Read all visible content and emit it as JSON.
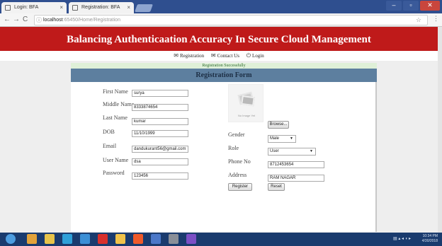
{
  "browser": {
    "tabs": [
      {
        "label": "Login: BFA"
      },
      {
        "label": "Registration: BFA"
      }
    ],
    "tab_close": "×",
    "address": {
      "host": "localhost",
      "rest": ":65450/Home/Registration"
    },
    "win_controls": {
      "minimize": "–",
      "maximize": "▫",
      "close": "✕"
    },
    "nav": {
      "back": "←",
      "forward": "→",
      "reload": "C"
    }
  },
  "page": {
    "title": "Balancing Authenticaation Accuracy In Secure Cloud Management",
    "menu": [
      {
        "label": "Registration",
        "icon": "mail-icon",
        "glyph": "✉"
      },
      {
        "label": "Contact Us",
        "icon": "mail-icon",
        "glyph": "✉"
      },
      {
        "label": "Login",
        "icon": "power-icon",
        "glyph": "⏻"
      }
    ],
    "success_message": "Registration Successfully",
    "form_title": "Registration Form"
  },
  "form": {
    "first_name": {
      "label": "First Name",
      "value": "surya"
    },
    "middle_name": {
      "label": "Middle Name",
      "value": "8333874654"
    },
    "last_name": {
      "label": "Last Name",
      "value": "kumar"
    },
    "dob": {
      "label": "DOB",
      "value": "11/10/1999"
    },
    "email": {
      "label": "Email",
      "value": "dandukurant56@gmail.com"
    },
    "user_name": {
      "label": "User Name",
      "value": "dsa"
    },
    "password": {
      "label": "Password",
      "value": "123456"
    },
    "photo_caption": "No Image Yet",
    "browse_label": "Browse...",
    "gender": {
      "label": "Gender",
      "value": "Male"
    },
    "role": {
      "label": "Role",
      "value": "User"
    },
    "phone": {
      "label": "Phone No",
      "value": "8712453654"
    },
    "address": {
      "label": "Address",
      "value": "RAM NAGAR"
    },
    "register_label": "Register",
    "reset_label": "Reset"
  },
  "taskbar": {
    "time": "10:34 PM",
    "date": "4/30/2018",
    "tray_text": "▤  ▴ ◂ ◖ ▸",
    "icon_colors": [
      "#4d9de0",
      "#e2a23a",
      "#e7c34a",
      "#2fa0d8",
      "#3b8fd6",
      "#d9302c",
      "#f0c24a",
      "#ef5a2a",
      "#4b78c9",
      "#8a8f98",
      "#7b4fc5"
    ]
  }
}
